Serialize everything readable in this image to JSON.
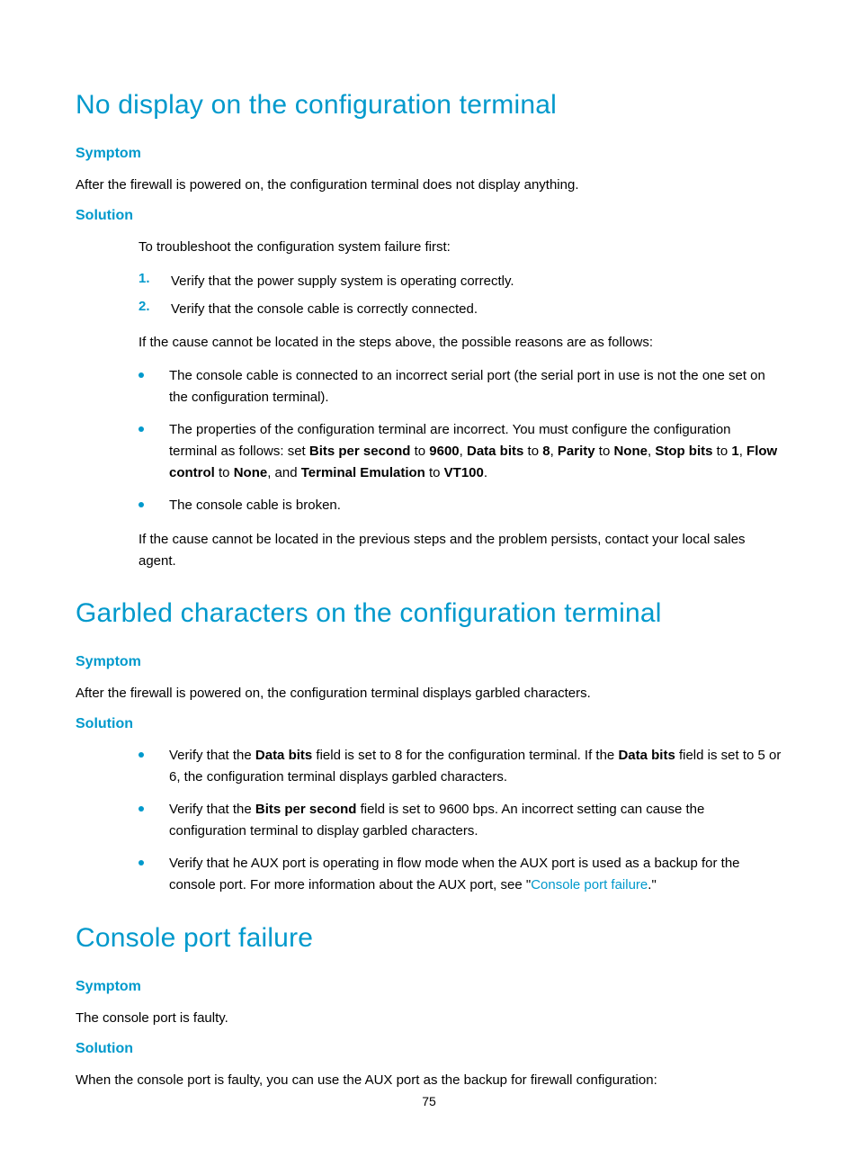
{
  "page_number": "75",
  "sections": [
    {
      "title": "No display on the configuration terminal",
      "symptom_heading": "Symptom",
      "symptom_text": "After the firewall is powered on, the configuration terminal does not display anything.",
      "solution_heading": "Solution",
      "solution_intro": "To troubleshoot the configuration system failure first:",
      "numbered": [
        {
          "n": "1.",
          "t": "Verify that the power supply system is operating correctly."
        },
        {
          "n": "2.",
          "t": "Verify that the console cable is correctly connected."
        }
      ],
      "after_numbered": "If the cause cannot be located in the steps above, the possible reasons are as follows:",
      "bullets": [
        "The console cable is connected to an incorrect serial port (the serial port in use is not the one set on the configuration terminal).",
        "__CONFIG_BULLET__",
        "The console cable is broken."
      ],
      "config_bullet_prefix": "The properties of the configuration terminal are incorrect. You must configure the configuration terminal as follows: set ",
      "config_terms": {
        "bps_label": "Bits per second",
        "bps_val": "9600",
        "db_label": "Data bits",
        "db_val": "8",
        "par_label": "Parity",
        "par_val": "None",
        "sb_label": "Stop bits",
        "sb_val": "1",
        "fc_label": "Flow control",
        "fc_val": "None",
        "te_label": "Terminal Emulation",
        "te_val": "VT100"
      },
      "after_bullets": "If the cause cannot be located in the previous steps and the problem persists, contact your local sales agent."
    },
    {
      "title": "Garbled characters on the configuration terminal",
      "symptom_heading": "Symptom",
      "symptom_text": "After the firewall is powered on, the configuration terminal displays garbled characters.",
      "solution_heading": "Solution",
      "bullets2": {
        "b1_pre": "Verify that the ",
        "b1_bold1": "Data bits",
        "b1_mid": " field is set to 8 for the configuration terminal. If the ",
        "b1_bold2": "Data bits",
        "b1_post": " field is set to 5 or 6, the configuration terminal displays garbled characters.",
        "b2_pre": "Verify that the ",
        "b2_bold": "Bits per second",
        "b2_post": " field is set to 9600 bps. An incorrect setting can cause the configuration terminal to display garbled characters.",
        "b3_pre": "Verify that he AUX port is operating in flow mode when the AUX port is used as a backup for the console port. For more information about the AUX port, see \"",
        "b3_link": "Console port failure",
        "b3_post": ".\""
      }
    },
    {
      "title": "Console port failure",
      "symptom_heading": "Symptom",
      "symptom_text": "The console port is faulty.",
      "solution_heading": "Solution",
      "solution_text": "When the console port is faulty, you can use the AUX port as the backup for firewall configuration:"
    }
  ]
}
